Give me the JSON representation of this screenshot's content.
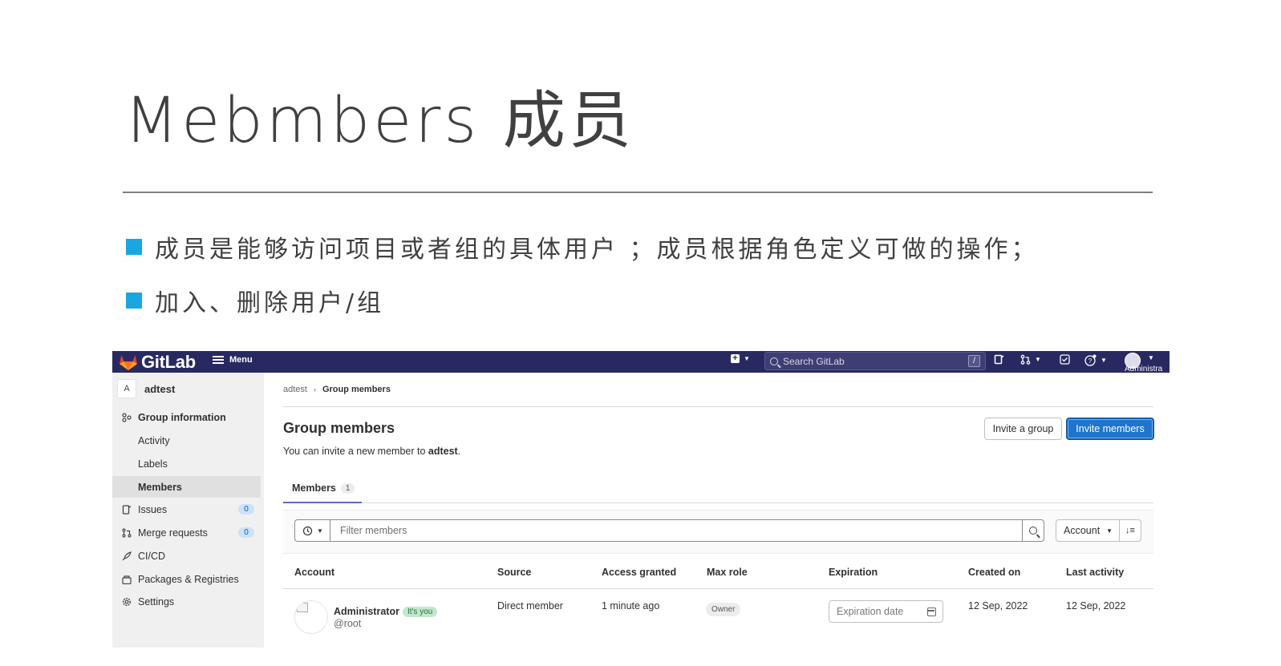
{
  "slide": {
    "title": "Mebmbers 成员",
    "bullets": [
      "成员是能够访问项目或者组的具体用户 ；成员根据角色定义可做的操作；",
      "加入、删除用户/组"
    ],
    "accent_color": "#1aa7df"
  },
  "gitlab": {
    "topbar": {
      "brand": "GitLab",
      "menu_label": "Menu",
      "search_placeholder": "Search GitLab",
      "search_shortcut": "/",
      "user_label": "Administra",
      "bg_color": "#292961",
      "icons": [
        "gitlab-logo-icon",
        "menu-icon",
        "plus-square-icon",
        "search-icon",
        "issues-icon",
        "merge-request-icon",
        "todo-icon",
        "help-icon",
        "avatar-icon"
      ]
    },
    "sidebar": {
      "group_avatar_letter": "A",
      "group_name": "adtest",
      "items": [
        {
          "label": "Group information",
          "icon": "group-icon"
        },
        {
          "label": "Activity"
        },
        {
          "label": "Labels"
        },
        {
          "label": "Members",
          "active": true
        },
        {
          "label": "Issues",
          "icon": "issues-icon",
          "count": "0"
        },
        {
          "label": "Merge requests",
          "icon": "merge-request-icon",
          "count": "0"
        },
        {
          "label": "CI/CD",
          "icon": "rocket-icon"
        },
        {
          "label": "Packages & Registries",
          "icon": "package-icon"
        },
        {
          "label": "Settings",
          "icon": "gear-icon"
        }
      ]
    },
    "breadcrumb": {
      "parent": "adtest",
      "current": "Group members"
    },
    "page": {
      "title": "Group members",
      "subtitle_prefix": "You can invite a new member to ",
      "subtitle_group": "adtest",
      "subtitle_suffix": ".",
      "invite_group_label": "Invite a group",
      "invite_members_label": "Invite members"
    },
    "tabs": [
      {
        "label": "Members",
        "count": "1"
      }
    ],
    "filter": {
      "placeholder": "Filter members",
      "sort_label": "Account"
    },
    "table": {
      "columns": [
        "Account",
        "Source",
        "Access granted",
        "Max role",
        "Expiration",
        "Created on",
        "Last activity"
      ],
      "rows": [
        {
          "name": "Administrator",
          "badge": "It's you",
          "handle": "@root",
          "source": "Direct member",
          "access_granted": "1 minute ago",
          "max_role": "Owner",
          "expiration_placeholder": "Expiration date",
          "created_on": "12 Sep, 2022",
          "last_activity": "12 Sep, 2022"
        }
      ]
    }
  }
}
